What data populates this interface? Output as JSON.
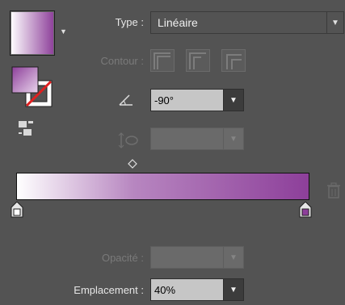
{
  "gradient": {
    "type_label": "Type :",
    "type_value": "Linéaire",
    "stroke_label": "Contour :",
    "angle_value": "-90°",
    "aspect_value": "",
    "opacity_label": "Opacité :",
    "opacity_value": "",
    "location_label": "Emplacement :",
    "location_value": "40%",
    "stops": [
      {
        "color": "#ffffff",
        "location": 0
      },
      {
        "color": "#8d3f9a",
        "location": 100
      }
    ],
    "midpoint_location": 40
  },
  "icons": {
    "type_arrow": "chevron-down-icon",
    "angle": "angle-icon",
    "aspect": "aspect-ratio-icon",
    "trash": "trash-icon",
    "arrange": "arrange-icon"
  },
  "colors": {
    "panel_bg": "#535353",
    "gradient_start": "#ffffff",
    "gradient_end": "#8d3f9a"
  }
}
